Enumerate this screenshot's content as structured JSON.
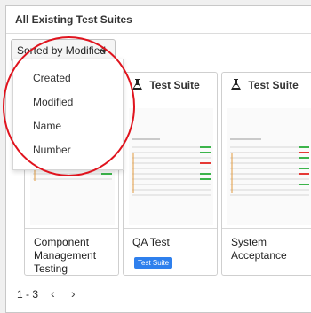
{
  "panel": {
    "title": "All Existing Test Suites"
  },
  "sort": {
    "label": "Sorted by Modified",
    "options": [
      "Created",
      "Modified",
      "Name",
      "Number"
    ]
  },
  "cards": [
    {
      "header": "",
      "name_lines": [
        "Component",
        "Management",
        "Testing"
      ],
      "badge": ""
    },
    {
      "header": "Test Suite",
      "name_lines": [
        "QA Test"
      ],
      "badge": "Test Suite"
    },
    {
      "header": "Test Suite",
      "name_lines": [
        "System",
        "Acceptance"
      ],
      "badge": ""
    }
  ],
  "pager": {
    "range": "1 - 3",
    "prev": "‹",
    "next": "›"
  },
  "colors": {
    "highlight_oval": "#e0141e",
    "badge": "#2f80ed"
  }
}
